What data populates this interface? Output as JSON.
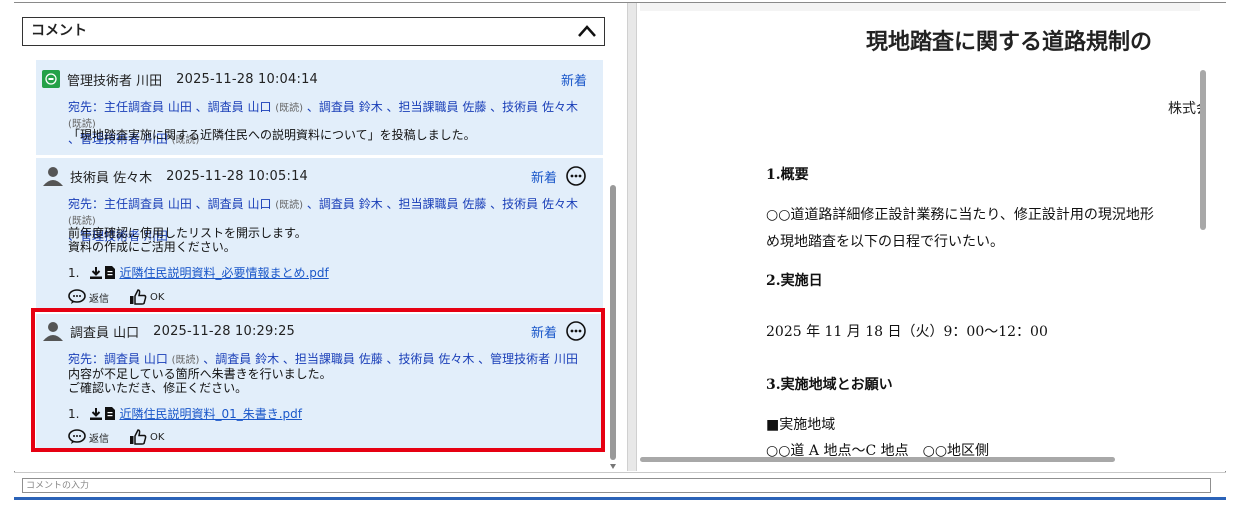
{
  "comment_panel": {
    "title": "コメント",
    "input_placeholder": "コメントの入力"
  },
  "comments": [
    {
      "author": "管理技術者 川田",
      "timestamp": "2025-11-28 10:04:14",
      "new_label": "新着",
      "to_line1": "宛先：主任調査員 山田 、調査員 山口",
      "read1": "(既読)",
      "to_line1b": "、調査員 鈴木 、担当課職員 佐藤 、技術員 佐々木",
      "read2": "(既読)",
      "to_line2": "、管理技術者 川田",
      "read3": "(既読)",
      "body": [
        "「現地踏査実施に関する近隣住民への説明資料について」を投稿しました。"
      ]
    },
    {
      "author": "技術員 佐々木",
      "timestamp": "2025-11-28 10:05:14",
      "new_label": "新着",
      "to_line1": "宛先：主任調査員 山田 、調査員 山口",
      "read1": "(既読)",
      "to_line1b": "、調査員 鈴木 、担当課職員 佐藤 、技術員 佐々木",
      "read2": "(既読)",
      "to_line2": "、管理技術者 川田",
      "body": [
        "前年度確認に使用したリストを開示します。",
        "資料の作成にご活用ください。"
      ],
      "attachment_num": "1.",
      "attachment": "近隣住民説明資料_必要情報まとめ.pdf",
      "reply_label": "返信",
      "ok_label": "OK"
    },
    {
      "author": "調査員 山口",
      "timestamp": "2025-11-28 10:29:25",
      "new_label": "新着",
      "to_line1": "宛先：調査員 山口",
      "read1": "(既読)",
      "to_line1b": "、調査員 鈴木 、担当課職員 佐藤 、技術員 佐々木 、管理技術者 川田",
      "body": [
        "内容が不足している箇所へ朱書きを行いました。",
        "ご確認いただき、修正ください。"
      ],
      "attachment_num": "1.",
      "attachment": "近隣住民説明資料_01_朱書き.pdf",
      "reply_label": "返信",
      "ok_label": "OK"
    }
  ],
  "document": {
    "title": "現地踏査に関する道路規制の",
    "company": "株式会",
    "h1": "1.概要",
    "p1a": "○○道道路詳細修正設計業務に当たり、修正設計用の現況地形",
    "p1b": "め現地踏査を以下の日程で行いたい。",
    "h2": "2.実施日",
    "date": "2025 年 11 月 18 日（火）9：00～12：00",
    "h3": "3.実施地域とお願い",
    "area_label": "■実施地域",
    "area": "○○道 A 地点～C 地点　○○地区側"
  },
  "colors": {
    "card_bg": "#e2eefa",
    "highlight": "#e60012",
    "link": "#1a57c9",
    "avatar_green": "#24a148"
  }
}
